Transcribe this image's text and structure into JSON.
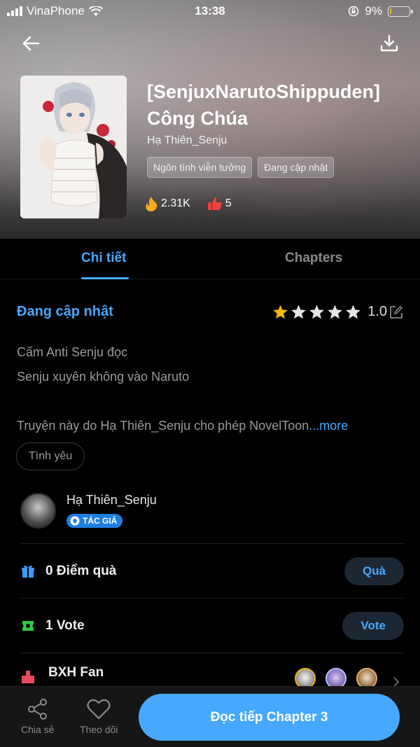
{
  "status_bar": {
    "carrier": "VinaPhone",
    "time": "13:38",
    "battery": "9%",
    "battery_level": 0.09
  },
  "book": {
    "title": "[SenjuxNarutoShippuden] Công Chúa",
    "author": "Hạ Thiên_Senju",
    "tags": [
      "Ngôn tình viễn tưởng",
      "Đang cập nhật"
    ],
    "views": "2.31K",
    "likes": "5"
  },
  "tabs": {
    "details": "Chi tiết",
    "chapters": "Chapters"
  },
  "details": {
    "status": "Đang cập nhật",
    "rating": "1.0",
    "rating_stars_filled": 1,
    "rating_stars_total": 5,
    "description_line1": "Cấm Anti Senju đọc",
    "description_line2": "Senju xuyên không vào Naruto",
    "license_text": "Truyện này do Hạ Thiên_Senju cho phép NovelToon",
    "more_label": "...more",
    "genre_chip": "Tình yêu"
  },
  "author_section": {
    "name": "Hạ Thiên_Senju",
    "badge": "TÁC GIẢ"
  },
  "gift_row": {
    "label": "0 Điểm quà",
    "button": "Quà"
  },
  "vote_row": {
    "label": "1 Vote",
    "button": "Vote"
  },
  "fan_row": {
    "label": "BXH Fan"
  },
  "bottom_bar": {
    "share": "Chia sẻ",
    "follow": "Theo dõi",
    "continue": "Đọc tiếp Chapter 3"
  },
  "colors": {
    "accent": "#46a9ff",
    "star": "#f5b800",
    "fire": "#ffab1a",
    "thumb": "#e8423a",
    "gift": "#3d9bff",
    "vote": "#2ecc40"
  }
}
